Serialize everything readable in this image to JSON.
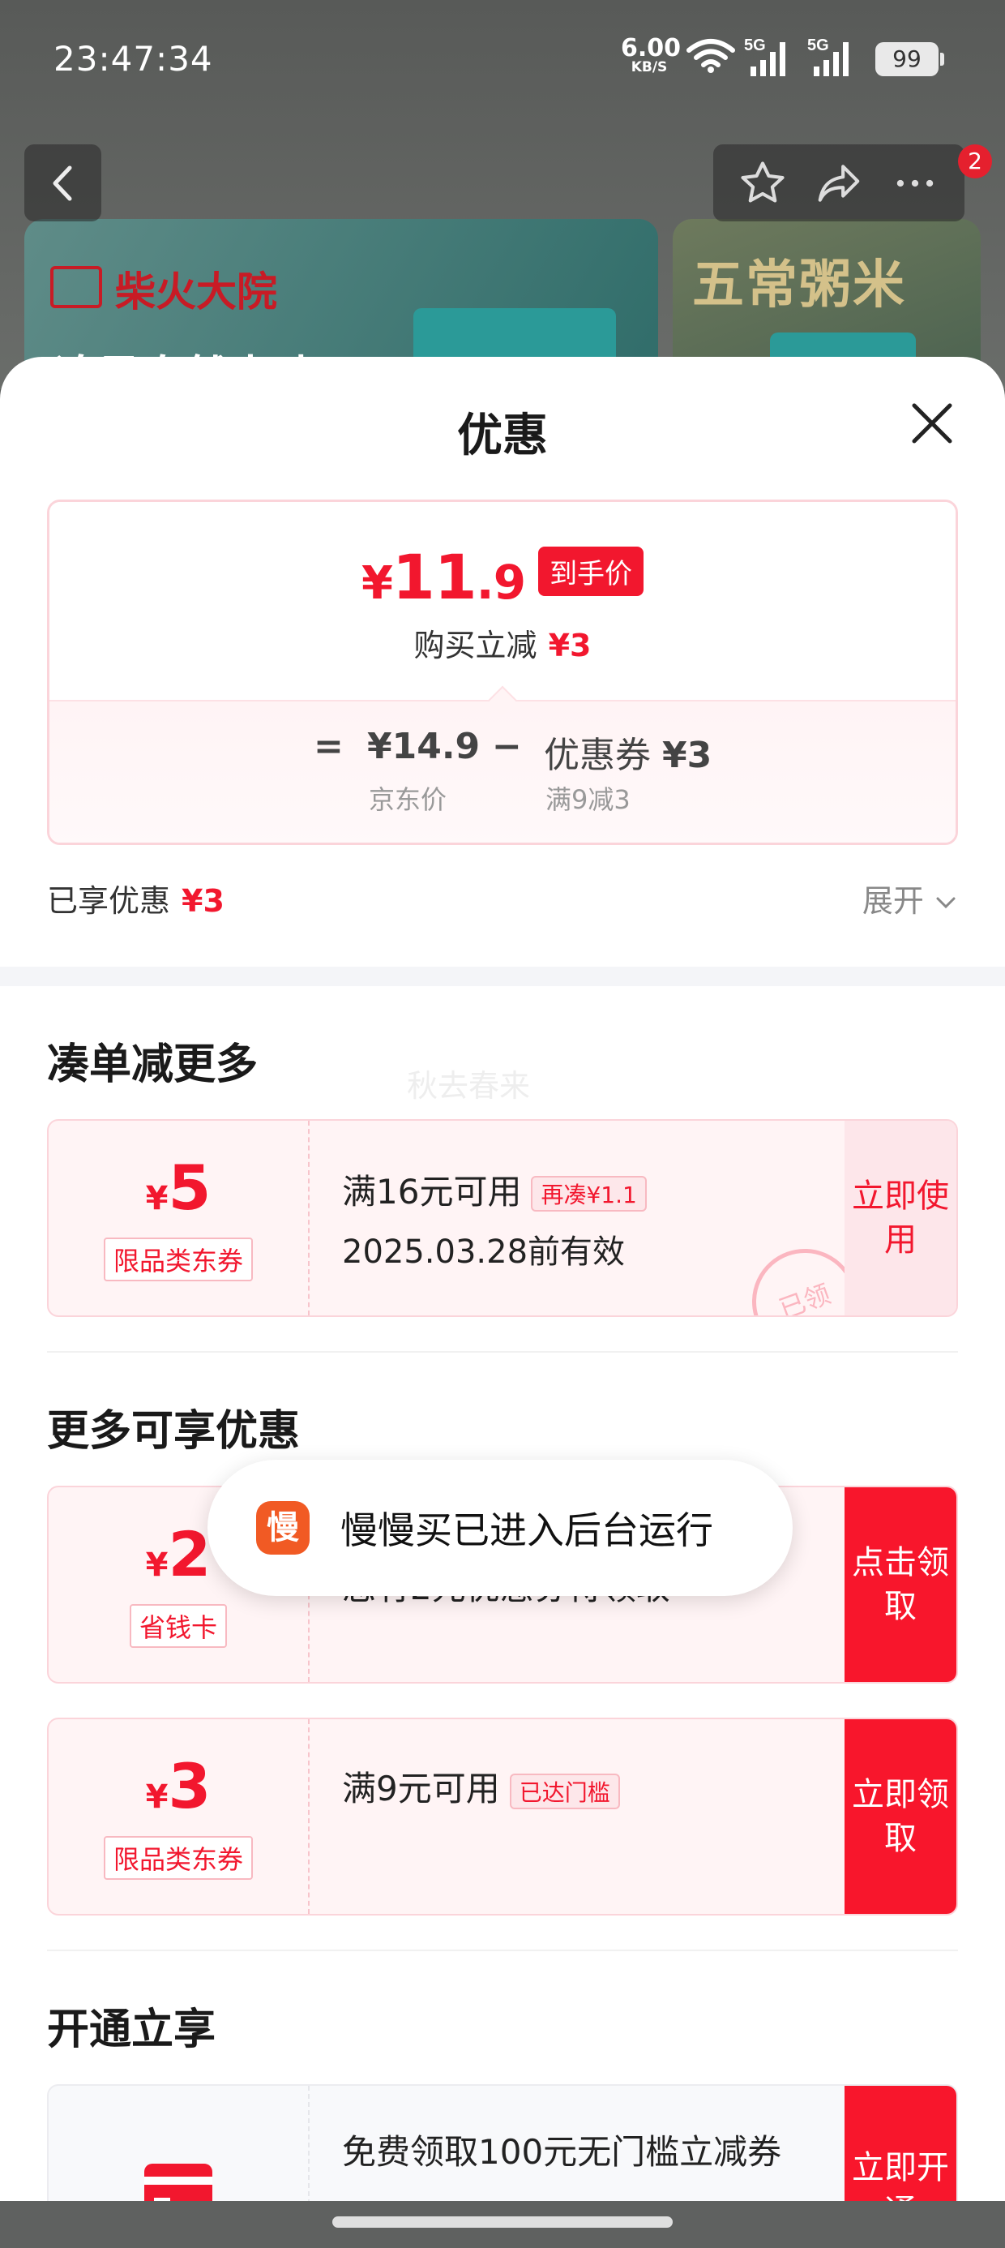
{
  "status_bar": {
    "time": "23:47:34",
    "net_speed": "6.00",
    "net_unit": "KB/S",
    "signal1": "5G",
    "signal2": "5G",
    "battery": "99"
  },
  "top_toolbar": {
    "badge_count": "2"
  },
  "banners": [
    {
      "brand": "柴火大院",
      "logo_text": "柴火大院",
      "tagline": "追寻自然本味"
    },
    {
      "brand": "五常粥米"
    }
  ],
  "sheet": {
    "title": "优惠",
    "price_card": {
      "final_price_yen": "¥",
      "final_price_int": "11",
      "final_price_dec": ".9",
      "final_price_tag": "到手价",
      "instant_discount_label": "购买立减",
      "instant_discount_value": "¥3",
      "eq_sign": "=",
      "jd_price": "¥14.9",
      "jd_price_label": "京东价",
      "minus_sign": "−",
      "coupon_label": "优惠券",
      "coupon_value": "¥3",
      "coupon_rule": "满9减3"
    },
    "saved": {
      "label": "已享优惠",
      "value": "¥3"
    },
    "expand_label": "展开",
    "watermark": "秋去春来",
    "section_bundle": {
      "title": "凑单减更多",
      "coupons": [
        {
          "amount": "5",
          "yen": "¥",
          "tag": "限品类东券",
          "line1": "满16元可用",
          "pill": "再凑¥1.1",
          "line2": "2025.03.28前有效",
          "button": "立即使用",
          "stamp": "已领"
        }
      ]
    },
    "section_more": {
      "title": "更多可享优惠",
      "coupons": [
        {
          "amount": "2",
          "yen": "¥",
          "tag": "省钱卡",
          "line1": "您有2元优惠券待领取",
          "button": "点击领取"
        },
        {
          "amount": "3",
          "yen": "¥",
          "tag": "限品类东券",
          "line1": "满9元可用",
          "pill": "已达门槛",
          "button": "立即领取"
        }
      ]
    },
    "section_open": {
      "title": "开通立享",
      "coupons": [
        {
          "line1": "免费领取100元无门槛立减券",
          "button": "立即开通"
        }
      ]
    }
  },
  "toast": {
    "icon_text": "慢",
    "text": "慢慢买已进入后台运行"
  },
  "colors": {
    "accent": "#f2172e",
    "button": "#f8162c",
    "toast_icon": "#f15a24"
  }
}
